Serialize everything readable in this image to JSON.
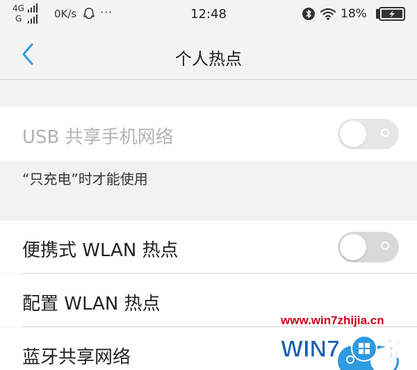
{
  "status_bar": {
    "network_top": "4G",
    "network_bottom": "G",
    "speed": "0K/s",
    "more": "···",
    "time": "12:48",
    "battery": "18%"
  },
  "header": {
    "title": "个人热点"
  },
  "settings": {
    "usb_tethering": {
      "label": "USB 共享手机网络",
      "enabled": false,
      "toggle_state": "off"
    },
    "usb_note": "“只充电”时才能使用",
    "wlan_hotspot": {
      "label": "便携式 WLAN 热点",
      "toggle_state": "off"
    },
    "configure_wlan": {
      "label": "配置 WLAN 热点"
    },
    "bluetooth_tethering": {
      "label": "蓝牙共享网络",
      "toggle_state": "on"
    }
  },
  "watermark": {
    "url": "www.win7zhijia.cn",
    "logo_text": "WIN7之家"
  },
  "colors": {
    "accent": "#2e9ae0",
    "toggle_on": "#2e9ae0",
    "toggle_off": "#d9d9d9",
    "disabled_text": "#b3b3b3",
    "watermark_red": "#d0021b"
  },
  "icons": [
    "signal-icon",
    "qq-icon",
    "bluetooth-icon",
    "wifi-icon",
    "battery-charging-icon",
    "back-arrow-icon"
  ]
}
